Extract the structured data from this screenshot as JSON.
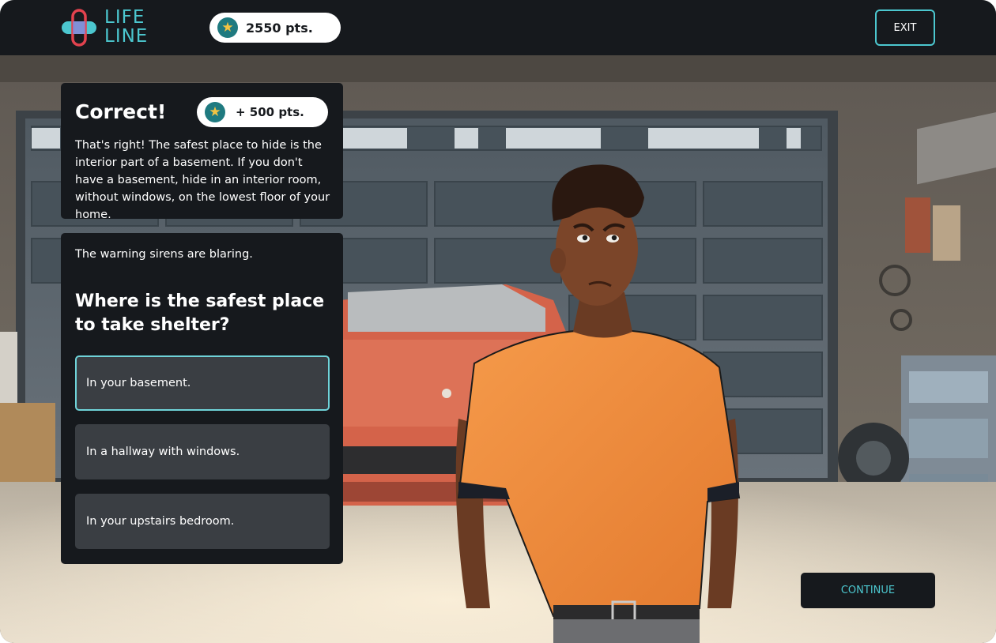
{
  "app": {
    "logo_line1": "LIFE",
    "logo_line2": "LINE"
  },
  "header": {
    "points": "2550 pts.",
    "exit_label": "EXIT"
  },
  "feedback": {
    "title": "Correct!",
    "bonus": "+ 500 pts.",
    "body": "That's right! The safest place to hide is the interior part of a basement. If you don't have a basement, hide in an interior room, without windows, on the lowest floor of your home."
  },
  "question_card": {
    "prompt": "The warning sirens are blaring.",
    "question": "Where is the safest place to take shelter?",
    "answers": [
      {
        "label": "In your basement.",
        "selected": true
      },
      {
        "label": "In a hallway with windows.",
        "selected": false
      },
      {
        "label": "In your upstairs bedroom.",
        "selected": false
      }
    ]
  },
  "continue_label": "CONTINUE",
  "colors": {
    "accent": "#4cc7cf",
    "panel": "#16191d",
    "answer_bg": "#3a3e43",
    "star": "#f4c343",
    "star_badge": "#1f7a80",
    "shirt": "#f28a3c",
    "car": "#d9674a"
  }
}
